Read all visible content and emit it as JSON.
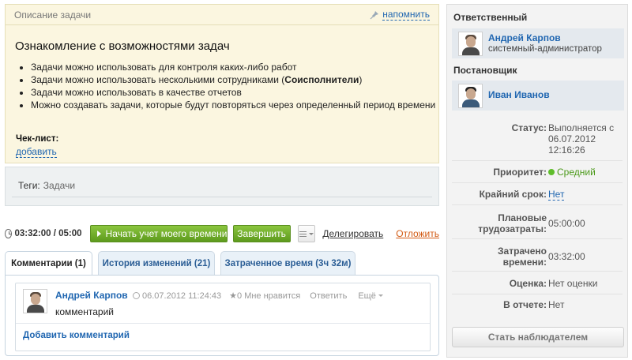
{
  "task": {
    "header_label": "Описание задачи",
    "remind_label": "напомнить",
    "title": "Ознакомление с возможностями задач",
    "bullets": [
      "Задачи можно использовать для контроля каких-либо работ",
      "Задачи можно использовать несколькими сотрудниками (",
      "Задачи можно использовать в качестве отчетов",
      "Можно создавать задачи, которые будут повторяться через определенный период времени"
    ],
    "bullet2_bold": "Соисполнители",
    "bullet2_tail": ")",
    "checklist_label": "Чек-лист:",
    "checklist_add": "добавить"
  },
  "tags": {
    "label": "Теги:",
    "value": "Задачи"
  },
  "toolbar": {
    "time": "03:32:00 / 05:00",
    "start_label": "Начать учет моего времени",
    "finish_label": "Завершить",
    "delegate_label": "Делегировать",
    "postpone_label": "Отложить"
  },
  "tabs": [
    {
      "label": "Комментарии (1)",
      "active": true
    },
    {
      "label": "История изменений (21)",
      "active": false
    },
    {
      "label": "Затраченное время (3ч 32м)",
      "active": false
    }
  ],
  "comment": {
    "author": "Андрей Карпов",
    "datetime": "06.07.2012 11:24:43",
    "likes": "0",
    "like_label": "Мне нравится",
    "reply_label": "Ответить",
    "more_label": "Ещё",
    "text": "комментарий",
    "add_label": "Добавить комментарий"
  },
  "sidebar": {
    "responsible_heading": "Ответственный",
    "responsible": {
      "name": "Андрей Карпов",
      "role": "системный-администратор"
    },
    "creator_heading": "Постановщик",
    "creator": {
      "name": "Иван Иванов"
    },
    "status_label": "Статус:",
    "status_value": "Выполняется с 06.07.2012 12:16:26",
    "priority_label": "Приоритет:",
    "priority_value": "Средний",
    "deadline_label": "Крайний срок:",
    "deadline_value": "Нет",
    "planned_label": "Плановые трудозатраты:",
    "planned_value": "05:00:00",
    "spent_label": "Затрачено времени:",
    "spent_value": "03:32:00",
    "rating_label": "Оценка:",
    "rating_value": "Нет оценки",
    "report_label": "В отчете:",
    "report_value": "Нет",
    "watch_button": "Стать наблюдателем"
  },
  "colors": {
    "link": "#2167b1",
    "green_button": "#6aa729",
    "postpone": "#d35b14",
    "task_bg": "#fbf6e0",
    "priority_dot": "#5fbd2b"
  }
}
